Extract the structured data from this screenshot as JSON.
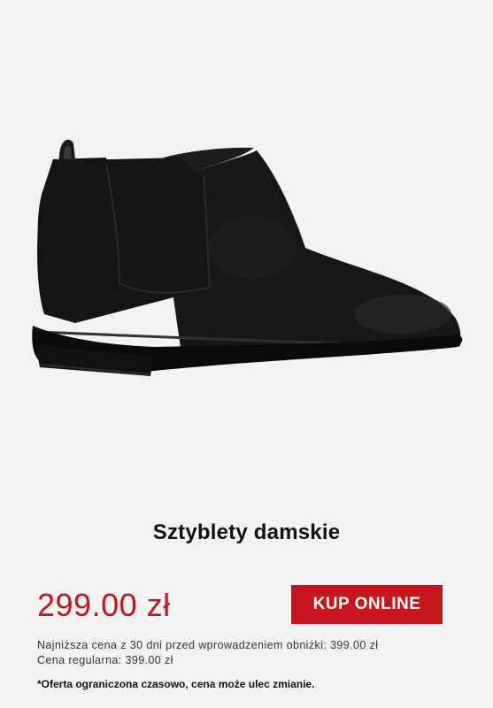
{
  "product": {
    "title": "Sztyblety damskie",
    "image_icon": "ankle-boot-image",
    "price": "299.00 zł",
    "buy_label": "KUP ONLINE",
    "lowest_price_note": "Najniższa cena z 30 dni przed wprowadzeniem obniżki: 399.00 zł",
    "regular_price_note": "Cena regularna: 399.00 zł",
    "disclaimer": "*Oferta ograniczona czasowo, cena może ulec zmianie."
  },
  "colors": {
    "accent": "#c8141b",
    "background": "#f4f3f4",
    "boot": "#161616"
  }
}
